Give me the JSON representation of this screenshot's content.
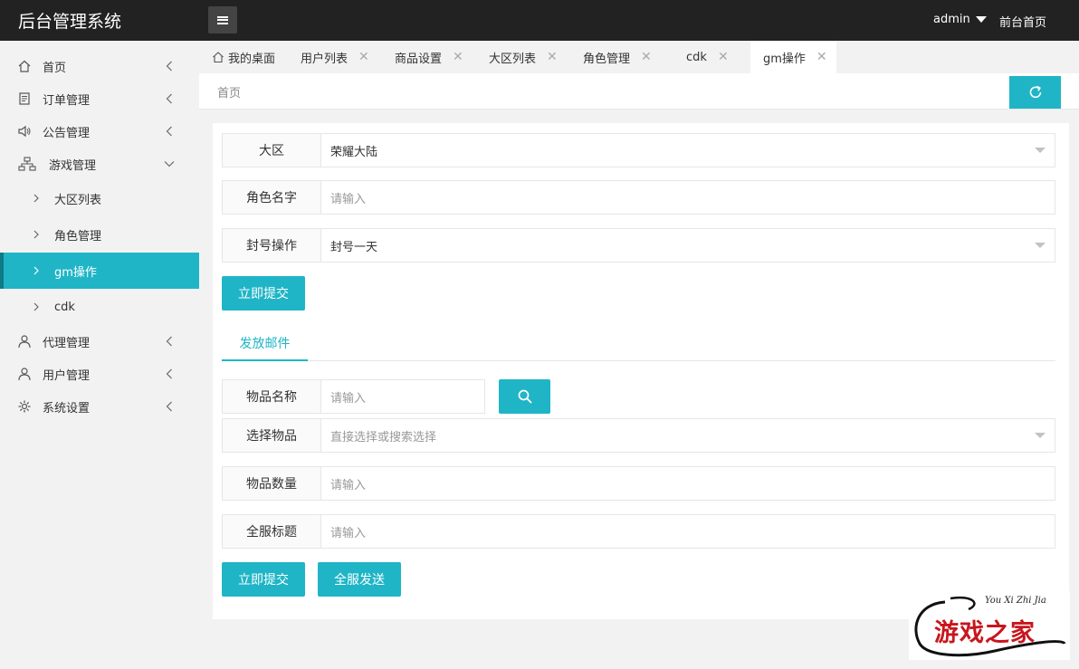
{
  "header": {
    "app_title": "后台管理系统",
    "user": "admin",
    "front_link": "前台首页"
  },
  "sidebar": {
    "items": [
      {
        "label": "首页",
        "icon": "home-icon"
      },
      {
        "label": "订单管理",
        "icon": "document-icon"
      },
      {
        "label": "公告管理",
        "icon": "speaker-icon"
      },
      {
        "label": "游戏管理",
        "icon": "sitemap-icon",
        "expanded": true
      },
      {
        "label": "代理管理",
        "icon": "user-icon"
      },
      {
        "label": "用户管理",
        "icon": "user-icon"
      },
      {
        "label": "系统设置",
        "icon": "gear-icon"
      }
    ],
    "game_sub": [
      {
        "label": "大区列表"
      },
      {
        "label": "角色管理"
      },
      {
        "label": "gm操作",
        "active": true
      },
      {
        "label": "cdk"
      }
    ]
  },
  "tabs": [
    {
      "label": "我的桌面"
    },
    {
      "label": "用户列表"
    },
    {
      "label": "商品设置"
    },
    {
      "label": "大区列表"
    },
    {
      "label": "角色管理"
    },
    {
      "label": "cdk"
    },
    {
      "label": "gm操作",
      "active": true
    }
  ],
  "tab_close_glyph": "✕",
  "breadcrumb": "首页",
  "form_gm": {
    "region_label": "大区",
    "region_value": "荣耀大陆",
    "role_label": "角色名字",
    "role_placeholder": "请输入",
    "ban_label": "封号操作",
    "ban_value": "封号一天",
    "submit_label": "立即提交"
  },
  "mail_tab": "发放邮件",
  "form_mail": {
    "item_name_label": "物品名称",
    "item_name_placeholder": "请输入",
    "select_item_label": "选择物品",
    "select_item_placeholder": "直接选择或搜索选择",
    "item_qty_label": "物品数量",
    "item_qty_placeholder": "请输入",
    "server_title_label": "全服标题",
    "server_title_placeholder": "请输入",
    "submit_label": "立即提交",
    "send_all_label": "全服发送"
  },
  "watermark": {
    "small": "You Xi Zhi Jia",
    "main": "游戏之家"
  },
  "colors": {
    "accent": "#1fb5c6",
    "header_bg": "#222222",
    "sidebar_active_border": "#0e7b87"
  }
}
